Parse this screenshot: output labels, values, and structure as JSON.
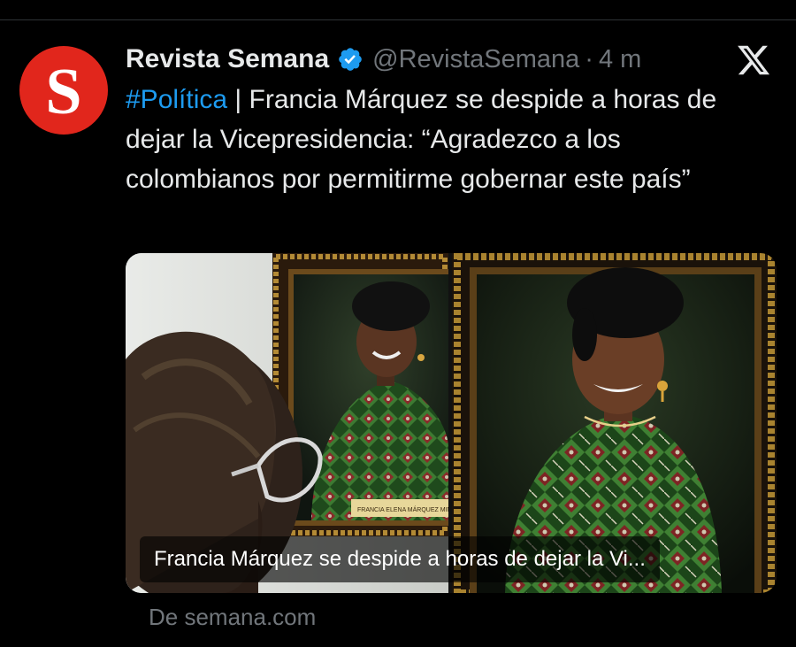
{
  "tweet": {
    "author_name": "Revista Semana",
    "handle": "@RevistaSemana",
    "separator": "·",
    "time": "4 m",
    "avatar_letter": "S",
    "hashtag": "#Política",
    "text_rest": " | Francia Márquez se despide a horas de dejar la Vicepresidencia: “Agradezco a los colombianos por permitirme gobernar este país”"
  },
  "card": {
    "caption": "Francia Márquez se despide a horas de dejar la Vi...",
    "nameplate": "FRANCIA ELENA MÁRQUEZ MINA",
    "source": "De semana.com"
  },
  "icons": {
    "verified": "verified-badge-icon",
    "platform": "x-logo-icon"
  },
  "colors": {
    "background": "#000000",
    "text": "#e7e9ea",
    "muted": "#71767b",
    "link": "#1d9bf0",
    "verified": "#1d9bf0",
    "avatar": "#e1261c"
  }
}
